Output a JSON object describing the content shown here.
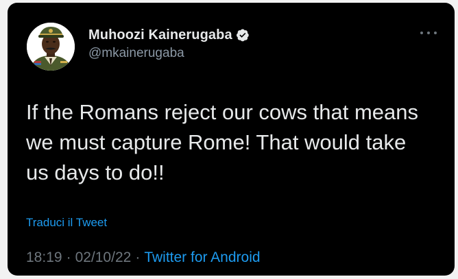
{
  "user": {
    "display_name": "Muhoozi Kainerugaba",
    "handle": "@mkainerugaba",
    "verified": true
  },
  "tweet": {
    "text": "If the Romans reject our cows that means we must capture Rome! That would take us days to do!!",
    "translate_label": "Traduci il Tweet",
    "time": "18:19",
    "date": "02/10/22",
    "separator": "·",
    "source": "Twitter for Android"
  },
  "icons": {
    "verified": "verified-badge-icon",
    "more": "more-options-icon"
  },
  "colors": {
    "background": "#000000",
    "text": "#e7e9ea",
    "secondary": "#8b98a5",
    "link": "#1d9bf0"
  }
}
